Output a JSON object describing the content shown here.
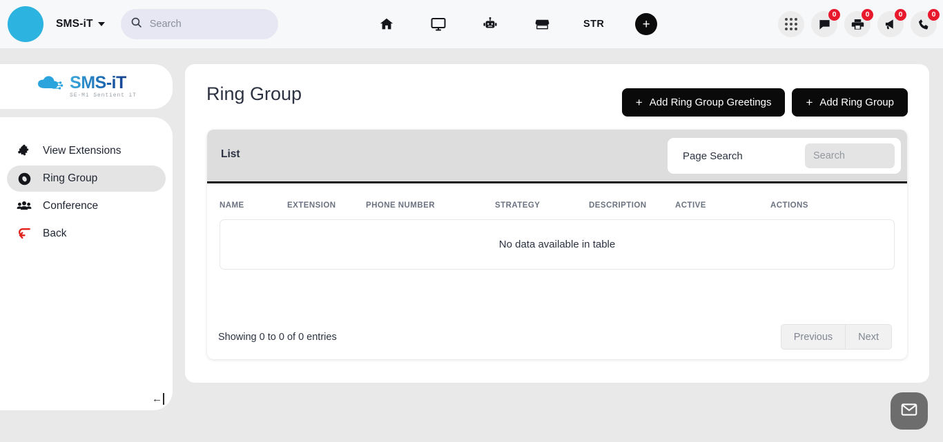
{
  "topbar": {
    "brand": "SMS-iT",
    "search_placeholder": "Search",
    "search_value": "",
    "center_nav": [
      {
        "name": "home-icon",
        "label": ""
      },
      {
        "name": "desktop-icon",
        "label": ""
      },
      {
        "name": "robot-icon",
        "label": ""
      },
      {
        "name": "store-icon",
        "label": ""
      },
      {
        "name": "str-label",
        "label": "STR"
      }
    ],
    "add_button": "+",
    "right_nav": [
      {
        "name": "apps-grid-icon",
        "badge": ""
      },
      {
        "name": "chat-icon",
        "badge": "0"
      },
      {
        "name": "printer-icon",
        "badge": "0"
      },
      {
        "name": "megaphone-icon",
        "badge": "0"
      },
      {
        "name": "phone-icon",
        "badge": "0"
      }
    ]
  },
  "sidebar": {
    "logo_main": "SMS-iT",
    "logo_sub": "SE-Mi Sentient iT",
    "items": [
      {
        "label": "View Extensions",
        "icon": "puzzle-icon",
        "active": false
      },
      {
        "label": "Ring Group",
        "icon": "ring-group-icon",
        "active": true
      },
      {
        "label": "Conference",
        "icon": "users-icon",
        "active": false
      },
      {
        "label": "Back",
        "icon": "back-arrow-icon",
        "active": false
      }
    ],
    "collapse": "←"
  },
  "main": {
    "title": "Ring Group",
    "buttons": [
      {
        "label": "Add Ring Group Greetings",
        "icon": "plus-icon"
      },
      {
        "label": "Add Ring Group",
        "icon": "plus-icon"
      }
    ],
    "tab_label": "List",
    "page_search_label": "Page Search",
    "page_search_placeholder": "Search",
    "page_search_value": "",
    "table": {
      "columns": [
        "NAME",
        "EXTENSION",
        "PHONE NUMBER",
        "STRATEGY",
        "DESCRIPTION",
        "ACTIVE",
        "ACTIONS"
      ],
      "rows": [],
      "empty_message": "No data available in table"
    },
    "entries_text": "Showing 0 to 0 of 0 entries",
    "pagination": {
      "previous": "Previous",
      "next": "Next"
    }
  },
  "fab": {
    "icon": "envelope-icon"
  },
  "colors": {
    "accent": "#2cb3e0",
    "badge": "#e8192c",
    "button_dark": "#0a0a0a",
    "page_bg": "#e9e9e9",
    "topbar_bg": "#f7f8fa"
  }
}
